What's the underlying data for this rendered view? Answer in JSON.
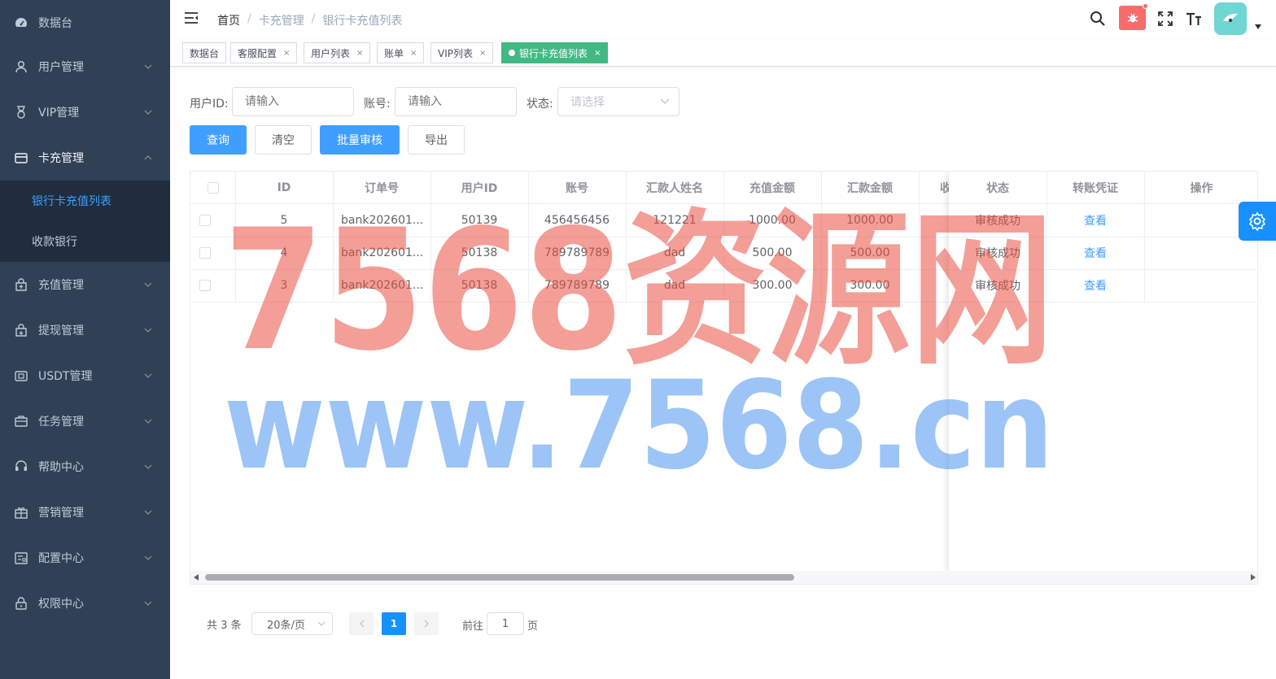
{
  "sidebar": {
    "items": [
      {
        "label": "数据台",
        "icon": "dashboard-icon"
      },
      {
        "label": "用户管理",
        "icon": "user-icon"
      },
      {
        "label": "VIP管理",
        "icon": "medal-icon"
      },
      {
        "label": "卡充管理",
        "icon": "card-icon"
      },
      {
        "label": "充值管理",
        "icon": "bag-upload-icon"
      },
      {
        "label": "提现管理",
        "icon": "bag-download-icon"
      },
      {
        "label": "USDT管理",
        "icon": "wallet-icon"
      },
      {
        "label": "任务管理",
        "icon": "briefcase-icon"
      },
      {
        "label": "帮助中心",
        "icon": "headset-icon"
      },
      {
        "label": "营销管理",
        "icon": "gift-icon"
      },
      {
        "label": "配置中心",
        "icon": "config-icon"
      },
      {
        "label": "权限中心",
        "icon": "lock-icon"
      }
    ],
    "submenu": [
      {
        "label": "银行卡充值列表",
        "active": true
      },
      {
        "label": "收款银行",
        "active": false
      }
    ]
  },
  "navbar": {
    "breadcrumb": [
      "首页",
      "卡充管理",
      "银行卡充值列表"
    ],
    "separator": "/"
  },
  "tags": [
    {
      "label": "数据台",
      "closable": false,
      "active": false
    },
    {
      "label": "客服配置",
      "closable": true,
      "active": false
    },
    {
      "label": "用户列表",
      "closable": true,
      "active": false
    },
    {
      "label": "账单",
      "closable": true,
      "active": false
    },
    {
      "label": "VIP列表",
      "closable": true,
      "active": false
    },
    {
      "label": "银行卡充值列表",
      "closable": true,
      "active": true
    }
  ],
  "tag_close": "×",
  "filters": {
    "user_id_label": "用户ID:",
    "user_id_placeholder": "请输入",
    "account_label": "账号:",
    "account_placeholder": "请输入",
    "status_label": "状态:",
    "status_placeholder": "请选择"
  },
  "buttons": {
    "query": "查询",
    "clear": "清空",
    "batch_review": "批量审核",
    "export": "导出"
  },
  "table": {
    "columns": [
      "ID",
      "订单号",
      "用户ID",
      "账号",
      "汇款人姓名",
      "充值金额",
      "汇款金额",
      "收"
    ],
    "fixed_columns": [
      "状态",
      "转账凭证",
      "操作"
    ],
    "rows": [
      {
        "id": "5",
        "order": "bank202601...",
        "user_id": "50139",
        "account": "456456456",
        "payer": "121221",
        "recharge": "1000.00",
        "remit": "1000.00",
        "status": "审核成功",
        "voucher": "查看"
      },
      {
        "id": "4",
        "order": "bank202601...",
        "user_id": "50138",
        "account": "789789789",
        "payer": "dad",
        "recharge": "500.00",
        "remit": "500.00",
        "status": "审核成功",
        "voucher": "查看"
      },
      {
        "id": "3",
        "order": "bank202601...",
        "user_id": "50138",
        "account": "789789789",
        "payer": "dad",
        "recharge": "300.00",
        "remit": "300.00",
        "status": "审核成功",
        "voucher": "查看"
      }
    ]
  },
  "pagination": {
    "total_text": "共 3 条",
    "page_size": "20条/页",
    "current_page": "1",
    "goto_prefix": "前往",
    "goto_value": "1",
    "goto_suffix": "页"
  },
  "watermark": {
    "line1": "7568资源网",
    "line2": "www.7568.cn"
  },
  "colors": {
    "sidebar_bg": "#304156",
    "submenu_bg": "#1f2d3d",
    "accent": "#409eff",
    "tag_active": "#42b983",
    "bug_badge": "#f56c6c"
  }
}
